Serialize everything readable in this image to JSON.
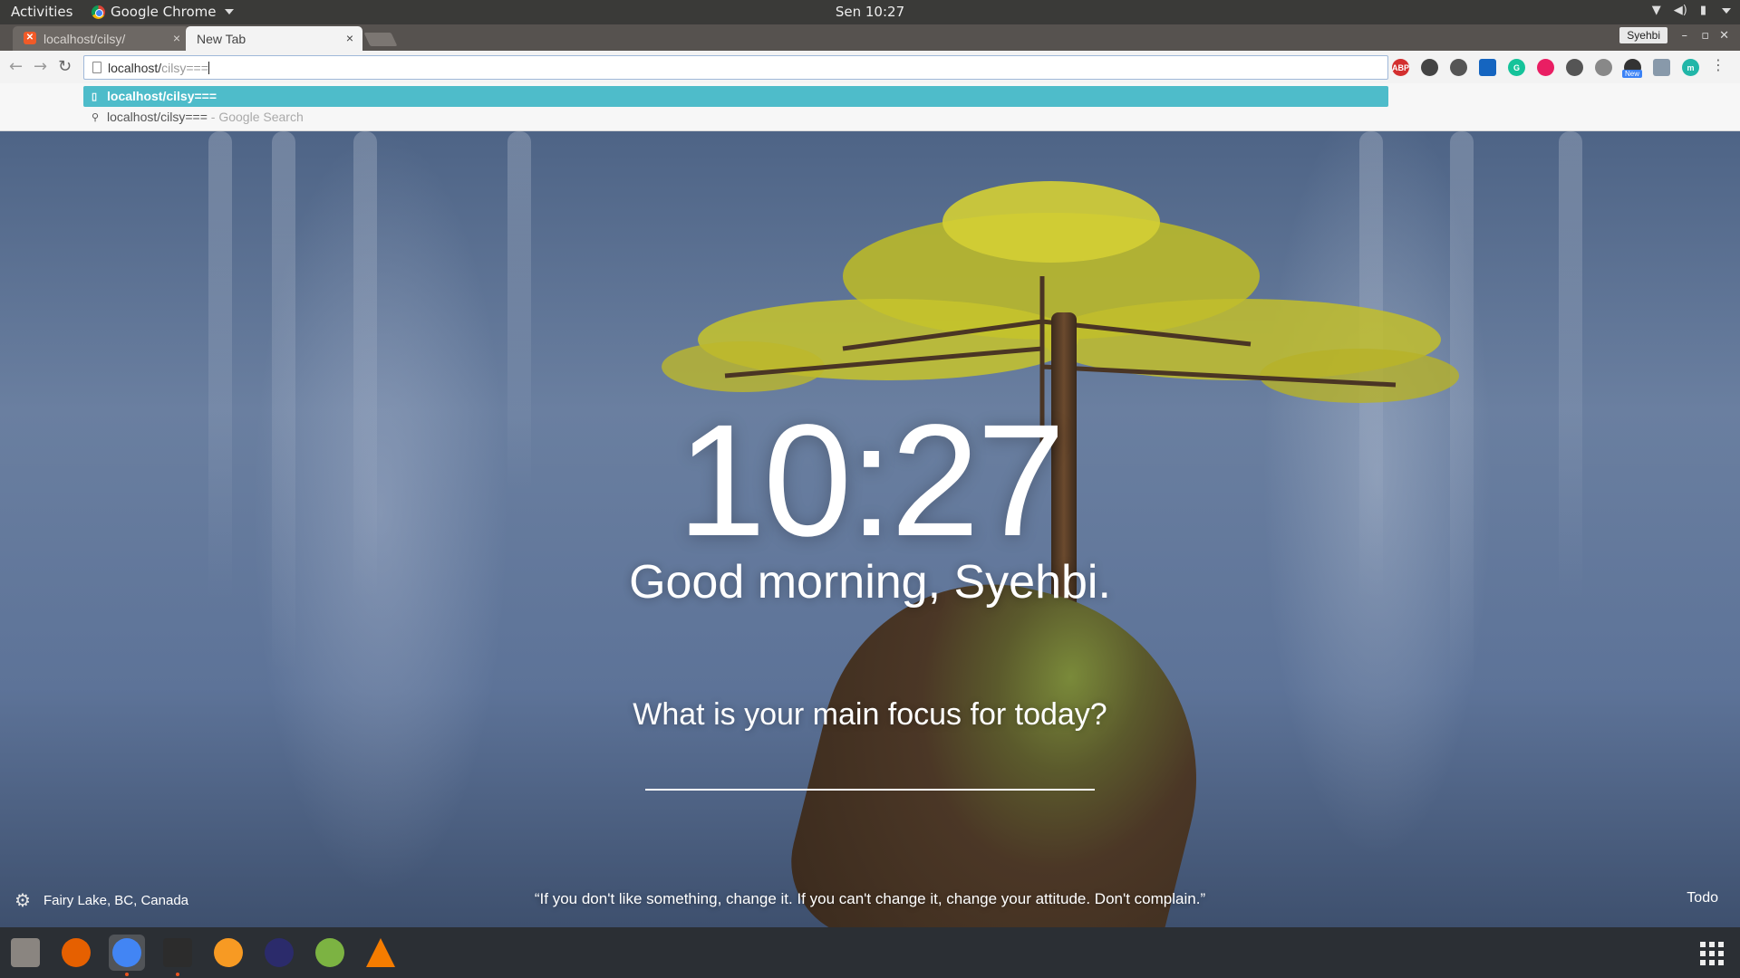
{
  "topbar": {
    "activities": "Activities",
    "app_name": "Google Chrome",
    "clock": "Sen 10:27"
  },
  "tabs": [
    {
      "title": "localhost/cilsy/",
      "favicon": "xampp-icon",
      "active": false
    },
    {
      "title": "New Tab",
      "active": true
    }
  ],
  "profile_name": "Syehbi",
  "omnibox": {
    "host": "localhost/",
    "path": "cilsy==="
  },
  "suggestions": {
    "selected": "localhost/cilsy===",
    "search_query": "localhost/cilsy===",
    "search_suffix": " - Google Search"
  },
  "extensions": [
    {
      "name": "adblock-plus-icon",
      "label": "ABP",
      "color": "#d32f2f"
    },
    {
      "name": "eyedropper-icon",
      "label": "",
      "color": "#444444"
    },
    {
      "name": "speedometer-icon",
      "label": "",
      "color": "#555555"
    },
    {
      "name": "trello-icon",
      "label": "",
      "color": "#1565c0"
    },
    {
      "name": "grammarly-icon",
      "label": "G",
      "color": "#15c39a"
    },
    {
      "name": "color-picker-icon",
      "label": "",
      "color": "#e91e63"
    },
    {
      "name": "mail-icon",
      "label": "",
      "color": "#555555"
    },
    {
      "name": "extension-icon",
      "label": "",
      "color": "#888888"
    },
    {
      "name": "lighthouse-icon",
      "label": "",
      "color": "#333333"
    },
    {
      "name": "code-icon",
      "label": "",
      "color": "#8899aa"
    },
    {
      "name": "momentum-icon",
      "label": "m",
      "color": "#21b6a8"
    }
  ],
  "new_badge": "New",
  "momentum": {
    "time": "10:27",
    "greeting": "Good morning, Syehbi.",
    "focus_question": "What is your main focus for today?",
    "location": "Fairy Lake, BC, Canada",
    "quote": "“If you don't like something, change it. If you can't change it, change your attitude. Don't complain.”",
    "todo": "Todo"
  },
  "dock": [
    {
      "name": "files-icon",
      "color": "#8a8580",
      "running": false
    },
    {
      "name": "firefox-icon",
      "color": "#e66000",
      "running": false
    },
    {
      "name": "chrome-icon",
      "color": "#4285f4",
      "running": true,
      "active": true
    },
    {
      "name": "terminal-icon",
      "color": "#2c2c2c",
      "running": true
    },
    {
      "name": "sublime-text-icon",
      "color": "#f79a23",
      "running": false
    },
    {
      "name": "visual-studio-code-icon",
      "color": "#2b2b6b",
      "running": false
    },
    {
      "name": "android-studio-icon",
      "color": "#7cb342",
      "running": false
    },
    {
      "name": "vlc-icon",
      "color": "#f57c00",
      "running": false
    }
  ]
}
